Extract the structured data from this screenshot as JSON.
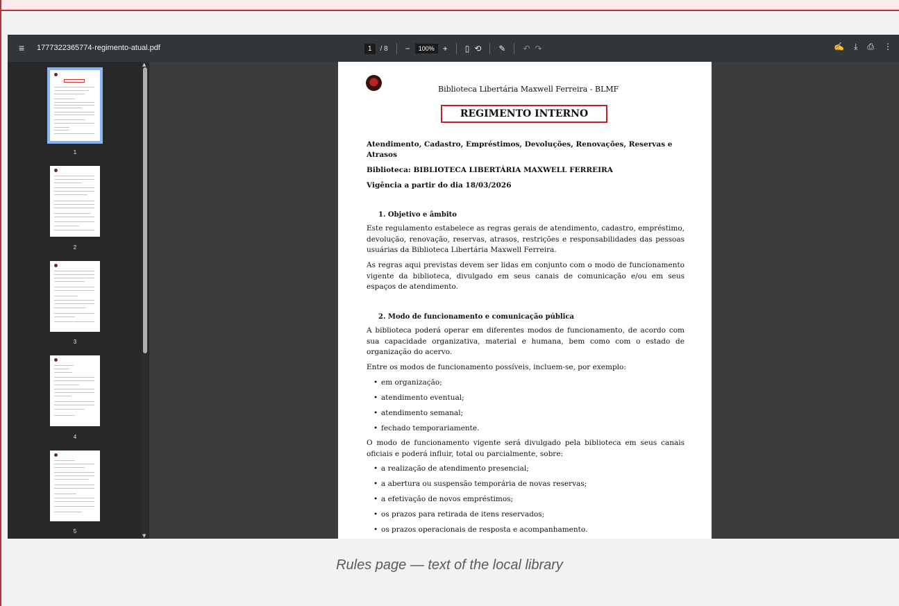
{
  "viewer": {
    "filename": "1777322365774-regimento-atual.pdf",
    "current_page": "1",
    "total_pages": "/ 8",
    "zoom": "100%",
    "icons": {
      "menu": "hamburger-menu-icon",
      "zoom_out": "minus-icon",
      "zoom_in": "plus-icon",
      "fit": "fit-page-icon",
      "rotate": "rotate-icon",
      "annotate": "draw-icon",
      "undo": "undo-icon",
      "redo": "redo-icon",
      "annotate_right": "annotate-icon",
      "download": "download-icon",
      "print": "print-icon",
      "more": "more-vert-icon"
    }
  },
  "thumbnails": [
    {
      "label": "1"
    },
    {
      "label": "2"
    },
    {
      "label": "3"
    },
    {
      "label": "4"
    },
    {
      "label": "5"
    }
  ],
  "document": {
    "library_name": "Biblioteca Libertária Maxwell Ferreira - BLMF",
    "title": "REGIMENTO INTERNO",
    "subtitle_line1": "Atendimento, Cadastro, Empréstimos, Devoluções, Renovações, Reservas e",
    "subtitle_line2": "Atrasos",
    "library_line": "Biblioteca: BIBLIOTECA LIBERTÁRIA MAXWELL FERREIRA",
    "validity": "Vigência a partir do dia 18/03/2026",
    "section1_title": "1. Objetivo e âmbito",
    "section1_p1": "Este regulamento estabelece as regras gerais de atendimento, cadastro, empréstimo, devolução, renovação, reservas, atrasos, restrições e responsabilidades das pessoas usuárias da Biblioteca Libertária Maxwell Ferreira.",
    "section1_p2": "As regras aqui previstas devem ser lidas em conjunto com o modo de funcionamento vigente da biblioteca, divulgado em seus canais de comunicação e/ou em seus espaços de atendimento.",
    "section2_title": "2. Modo de funcionamento e comunicação pública",
    "section2_p1": "A biblioteca poderá operar em diferentes modos de funcionamento, de acordo com sua capacidade organizativa, material e humana, bem como com o estado de organização do acervo.",
    "section2_p2": "Entre os modos de funcionamento possíveis, incluem-se, por exemplo:",
    "modes": [
      "em organização;",
      "atendimento eventual;",
      "atendimento semanal;",
      "fechado temporariamente."
    ],
    "section2_p3": "O modo de funcionamento vigente será divulgado pela biblioteca em seus canais oficiais e poderá influir, total ou parcialmente, sobre:",
    "impacts": [
      "a realização de atendimento presencial;",
      "a abertura ou suspensão temporária de novas reservas;",
      "a efetivação de novos empréstimos;",
      "os prazos para retirada de itens reservados;",
      "os prazos operacionais de resposta e acompanhamento."
    ]
  },
  "caption": "Rules page — text of the local library"
}
